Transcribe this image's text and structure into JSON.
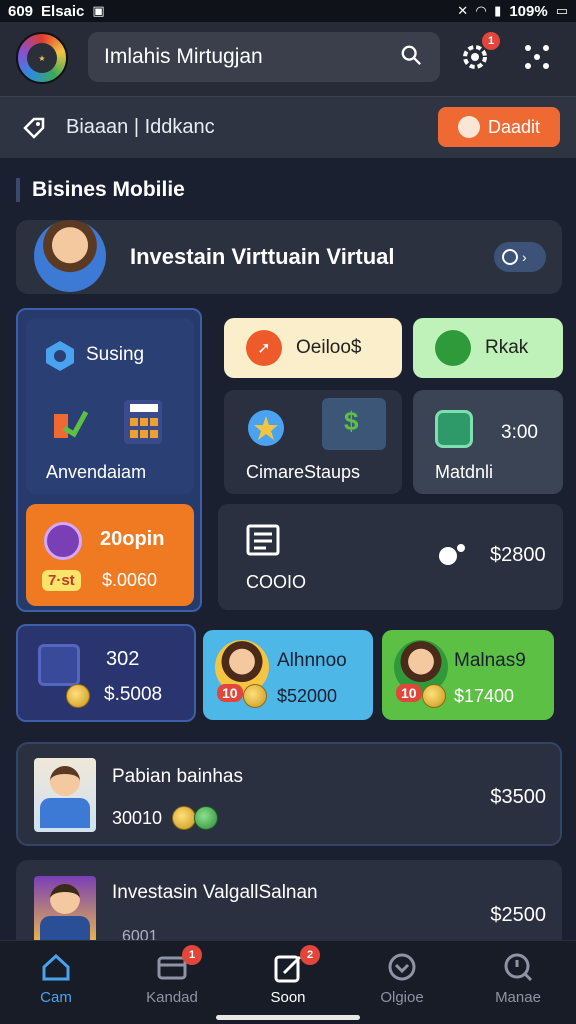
{
  "status": {
    "time": "609",
    "carrier": "Elsaic",
    "battery": "109%"
  },
  "header": {
    "search_value": "Imlahis Mirtugjan",
    "notif_count": "1"
  },
  "subbar": {
    "text": "Biaaan  |  Iddkanc",
    "deal_label": "Daadit"
  },
  "section": {
    "title": "Bisines Mobilie"
  },
  "banner": {
    "title": "Investain Virttuain Virtual"
  },
  "left_panel": {
    "title": "Susing",
    "app_label": "Anvendaiam",
    "promo_title": "20opin",
    "promo_tag": "7·st",
    "promo_value": "$.0060"
  },
  "tiles": {
    "t1": "Oeiloo$",
    "t2": "Rkak",
    "t3": "CimareStaups",
    "t4_value": "3:00",
    "t4_label": "Matdnli",
    "t5_label": "COOIO",
    "t5_value": "$2800"
  },
  "cards_row": [
    {
      "title": "302",
      "value": "$.5008"
    },
    {
      "title": "Alhnnoo",
      "badge": "10",
      "value": "$52000"
    },
    {
      "title": "Malnas9",
      "badge": "10",
      "value": "$17400"
    }
  ],
  "list": [
    {
      "title": "Pabian bainhas",
      "sub": "30010",
      "price": "$3500"
    },
    {
      "title": "Investasin ValgallSalnan",
      "sub": "6001",
      "price": "$2500"
    }
  ],
  "nav": [
    {
      "label": "Cam",
      "badge": ""
    },
    {
      "label": "Kandad",
      "badge": "1"
    },
    {
      "label": "Soon",
      "badge": "2"
    },
    {
      "label": "Olgioe",
      "badge": ""
    },
    {
      "label": "Manae",
      "badge": ""
    }
  ],
  "colors": {
    "accent_orange": "#ef6a33",
    "panel_blue": "#263a6b",
    "tile_yellow": "#fbeeca",
    "tile_green": "#bff2b8",
    "card_blue": "#4db8e8",
    "card_green": "#5cc044"
  }
}
